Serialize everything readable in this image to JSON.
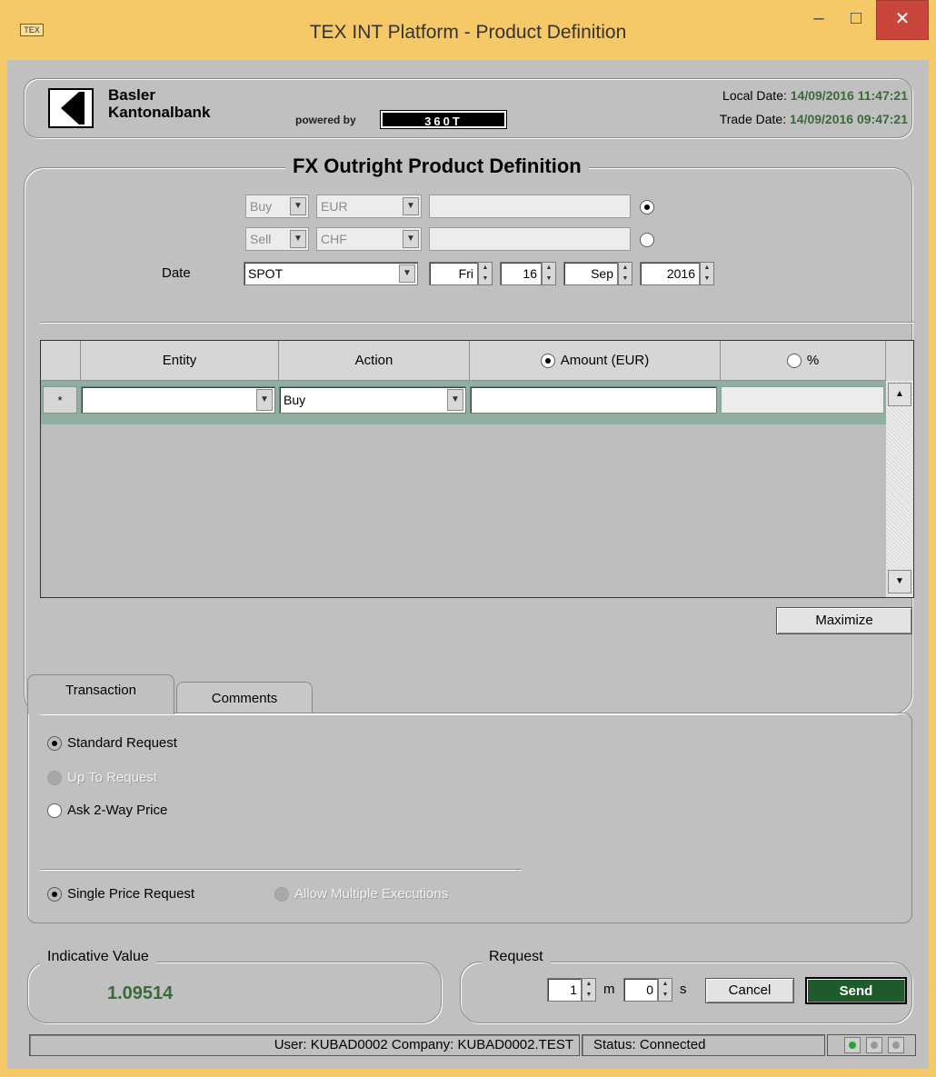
{
  "window": {
    "title": "TEX INT Platform - Product Definition",
    "icon_label": "TEX",
    "minimize": "–",
    "maximize": "□",
    "close": "✕"
  },
  "header": {
    "bank_line1": "Basler",
    "bank_line2": "Kantonalbank",
    "powered_by": "powered by",
    "powered_brand": "360T",
    "local_date_label": "Local Date:",
    "local_date_value": "14/09/2016 11:47:21",
    "trade_date_label": "Trade Date:",
    "trade_date_value": "14/09/2016 09:47:21"
  },
  "product": {
    "title": "FX Outright Product Definition",
    "leg1": {
      "side": "Buy",
      "currency": "EUR",
      "amount": ""
    },
    "leg2": {
      "side": "Sell",
      "currency": "CHF",
      "amount": ""
    },
    "date_label": "Date",
    "tenor": "SPOT",
    "day_name": "Fri",
    "day": "16",
    "month": "Sep",
    "year": "2016"
  },
  "grid": {
    "columns": [
      "Entity",
      "Action",
      "Amount (EUR)",
      "%"
    ],
    "row_marker": "*",
    "row": {
      "entity": "",
      "action": "Buy",
      "amount": "",
      "percent": ""
    },
    "maximize_label": "Maximize"
  },
  "tabs": [
    {
      "label": "Transaction",
      "active": true
    },
    {
      "label": "Comments",
      "active": false
    }
  ],
  "transaction": {
    "standard_request": "Standard Request",
    "up_to_request": "Up To Request",
    "ask_two_way": "Ask 2-Way Price",
    "single_price": "Single Price Request",
    "allow_multiple": "Allow Multiple Executions"
  },
  "indicative": {
    "label": "Indicative Value",
    "value": "1.09514"
  },
  "request": {
    "label": "Request",
    "minutes": "1",
    "minutes_unit": "m",
    "seconds": "0",
    "seconds_unit": "s",
    "cancel": "Cancel",
    "send": "Send"
  },
  "statusbar": {
    "user_company": "User: KUBAD0002 Company: KUBAD0002.TEST",
    "status": "Status:  Connected"
  },
  "colors": {
    "accent_green": "#1f5a2a",
    "date_green": "#3a6a3a",
    "frame": "#f5c868"
  }
}
